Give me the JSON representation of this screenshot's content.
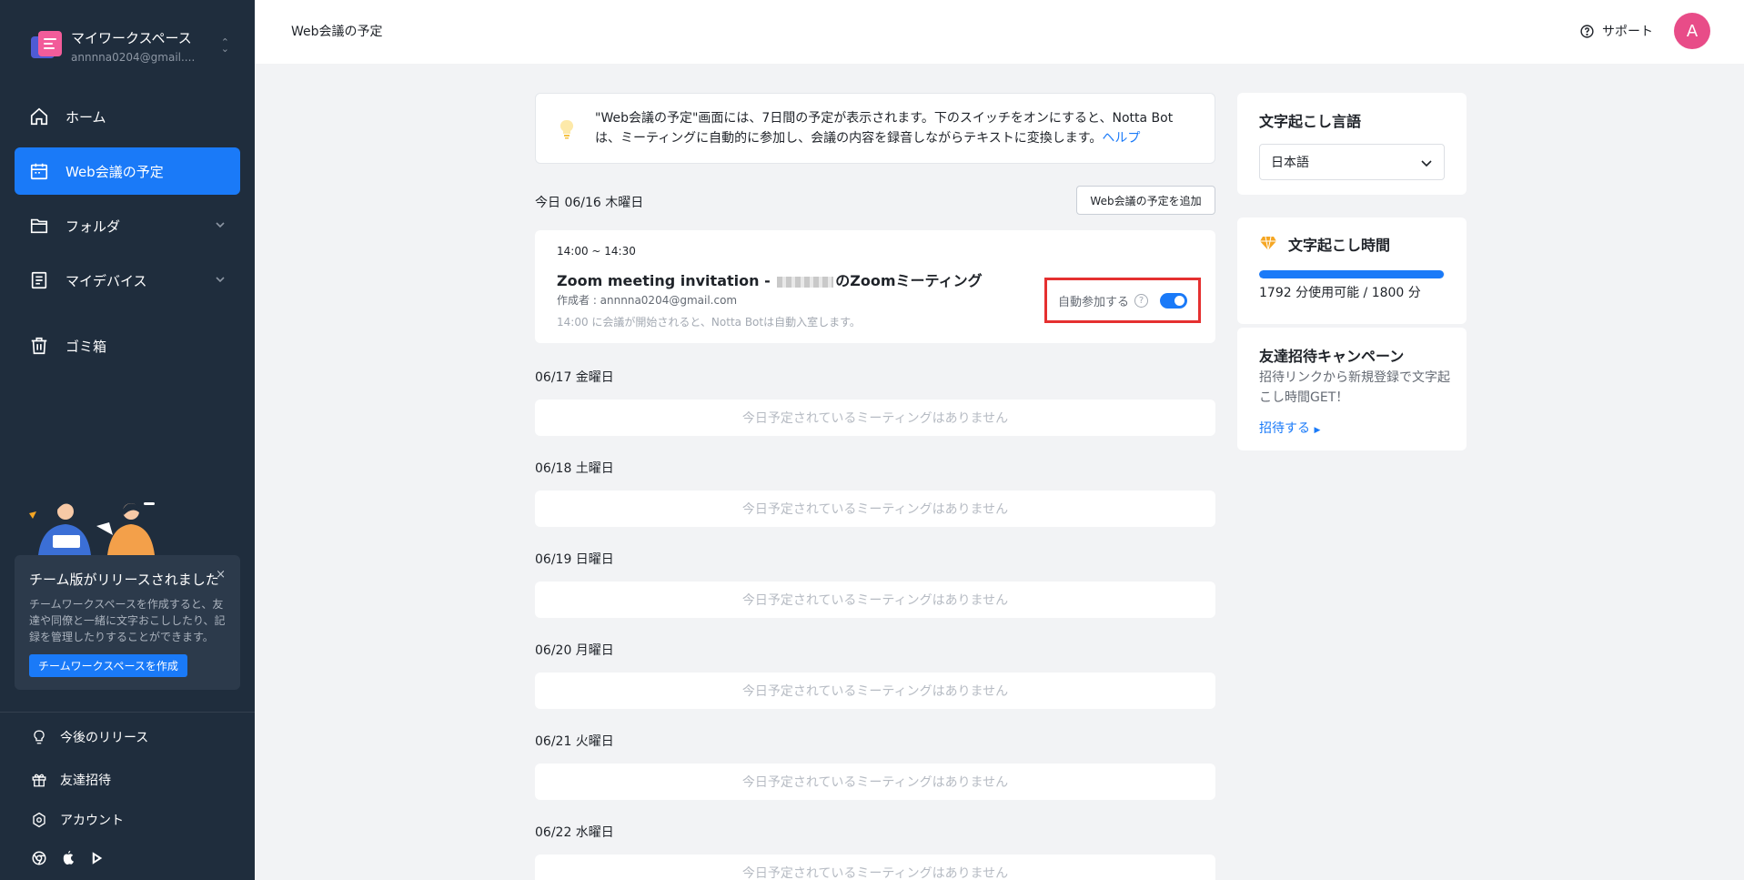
{
  "sidebar": {
    "workspace": {
      "name": "マイワークスペース",
      "email": "annnna0204@gmail...."
    },
    "nav": [
      {
        "label": "ホーム",
        "icon": "home-icon"
      },
      {
        "label": "Web会議の予定",
        "icon": "calendar-icon",
        "active": true
      },
      {
        "label": "フォルダ",
        "icon": "folder-icon"
      },
      {
        "label": "マイデバイス",
        "icon": "device-icon"
      },
      {
        "label": "ゴミ箱",
        "icon": "trash-icon"
      }
    ],
    "team_card": {
      "title": "チーム版がリリースされました",
      "close": "×",
      "description": "チームワークスペースを作成すると、友達や同僚と一緒に文字おこししたり、記録を管理したりすることができます。",
      "button": "チームワークスペースを作成"
    },
    "bottom": [
      {
        "label": "今後のリリース",
        "icon": "bulb-icon"
      },
      {
        "label": "友達招待",
        "icon": "gift-icon"
      },
      {
        "label": "アカウント",
        "icon": "settings-icon"
      }
    ],
    "apps": [
      "chrome-icon",
      "apple-icon",
      "google-play-icon"
    ]
  },
  "header": {
    "title": "Web会議の予定",
    "support": "サポート",
    "avatar": "A",
    "avatar_color": "#e84c88"
  },
  "tip": {
    "text": "\"Web会議の予定\"画面には、7日間の予定が表示されます。下のスイッチをオンにすると、Notta Botは、ミーティングに自動的に参加し、会議の内容を録音しながらテキストに変換します。",
    "link": "ヘルプ"
  },
  "schedule": {
    "today_label": "今日 06/16 木曜日",
    "add_button": "Web会議の予定を追加",
    "meeting": {
      "time": "14:00 ~ 14:30",
      "title_prefix": "Zoom meeting invitation - ",
      "title_suffix": "のZoomミーティング",
      "author": "作成者 : annnna0204@gmail.com",
      "note": "14:00 に会議が開始されると、Notta Botは自動入室します。",
      "auto_join_label": "自動参加する",
      "auto_join": true
    },
    "days": [
      {
        "label": "06/17 金曜日",
        "empty": "今日予定されているミーティングはありません"
      },
      {
        "label": "06/18 土曜日",
        "empty": "今日予定されているミーティングはありません"
      },
      {
        "label": "06/19 日曜日",
        "empty": "今日予定されているミーティングはありません"
      },
      {
        "label": "06/20 月曜日",
        "empty": "今日予定されているミーティングはありません"
      },
      {
        "label": "06/21 火曜日",
        "empty": "今日予定されているミーティングはありません"
      },
      {
        "label": "06/22 水曜日",
        "empty": "今日予定されているミーティングはありません"
      }
    ]
  },
  "right": {
    "language": {
      "title": "文字起こし言語",
      "value": "日本語"
    },
    "time": {
      "title": "文字起こし時間",
      "usage": "1792 分使用可能 / 1800 分",
      "fraction_available": 0.9956
    },
    "invite": {
      "title": "友達招待キャンペーン",
      "description": "招待リンクから新規登録で文字起こし時間GET！",
      "link": "招待する"
    }
  },
  "colors": {
    "sidebar": "#1f2d3d",
    "accent": "#1a7af8",
    "highlight": "#e53030"
  }
}
